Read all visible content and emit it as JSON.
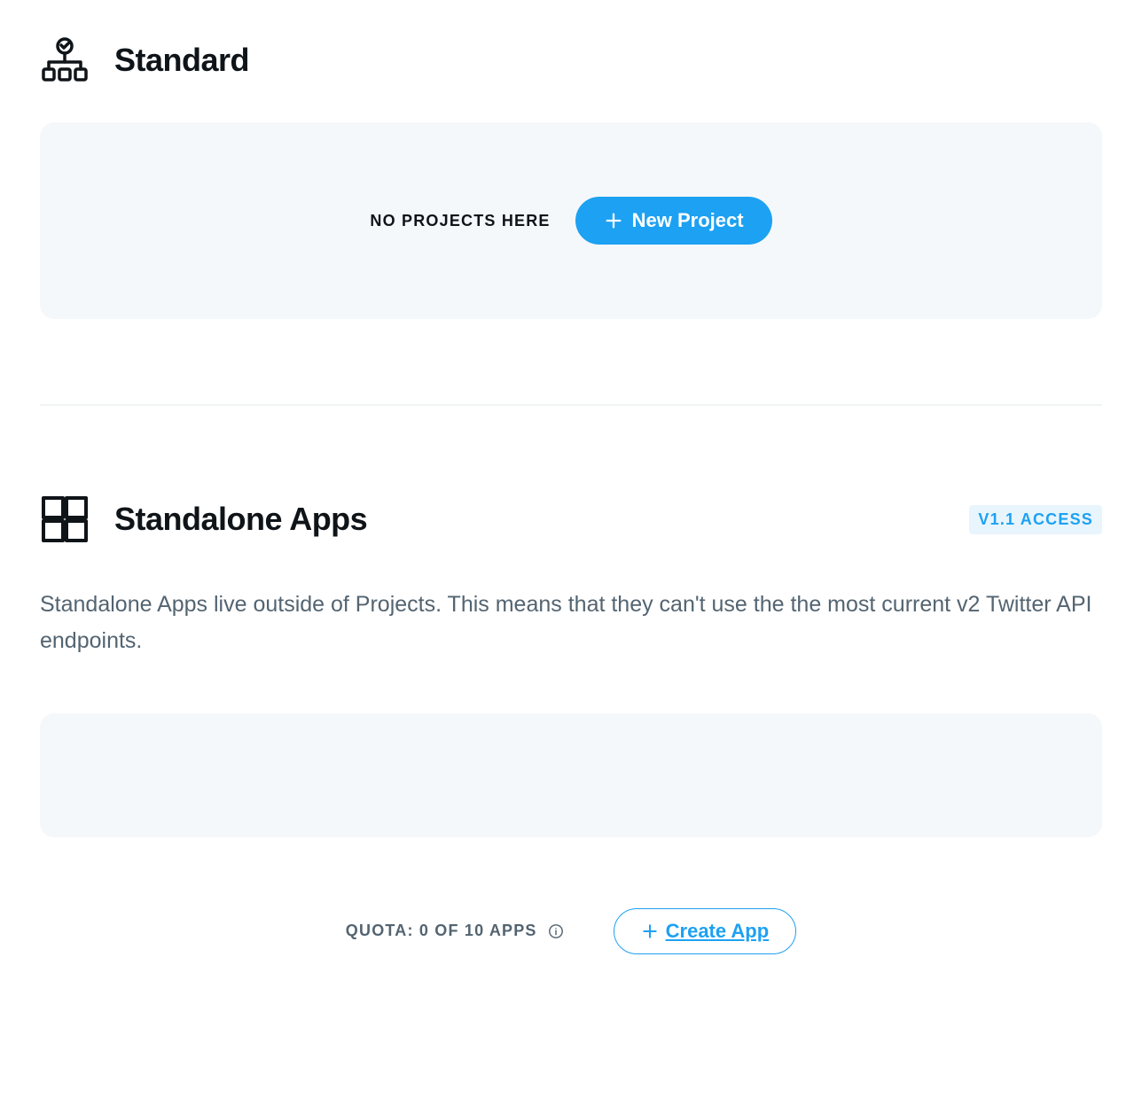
{
  "standard": {
    "title": "Standard",
    "empty_label": "No projects here",
    "new_project_label": "New Project"
  },
  "standalone": {
    "title": "Standalone Apps",
    "badge": "V1.1 Access",
    "description": "Standalone Apps live outside of Projects. This means that they can't use the the most current v2 Twitter API endpoints.",
    "quota_label": "Quota: 0 of 10 Apps",
    "create_app_label": "Create App"
  }
}
